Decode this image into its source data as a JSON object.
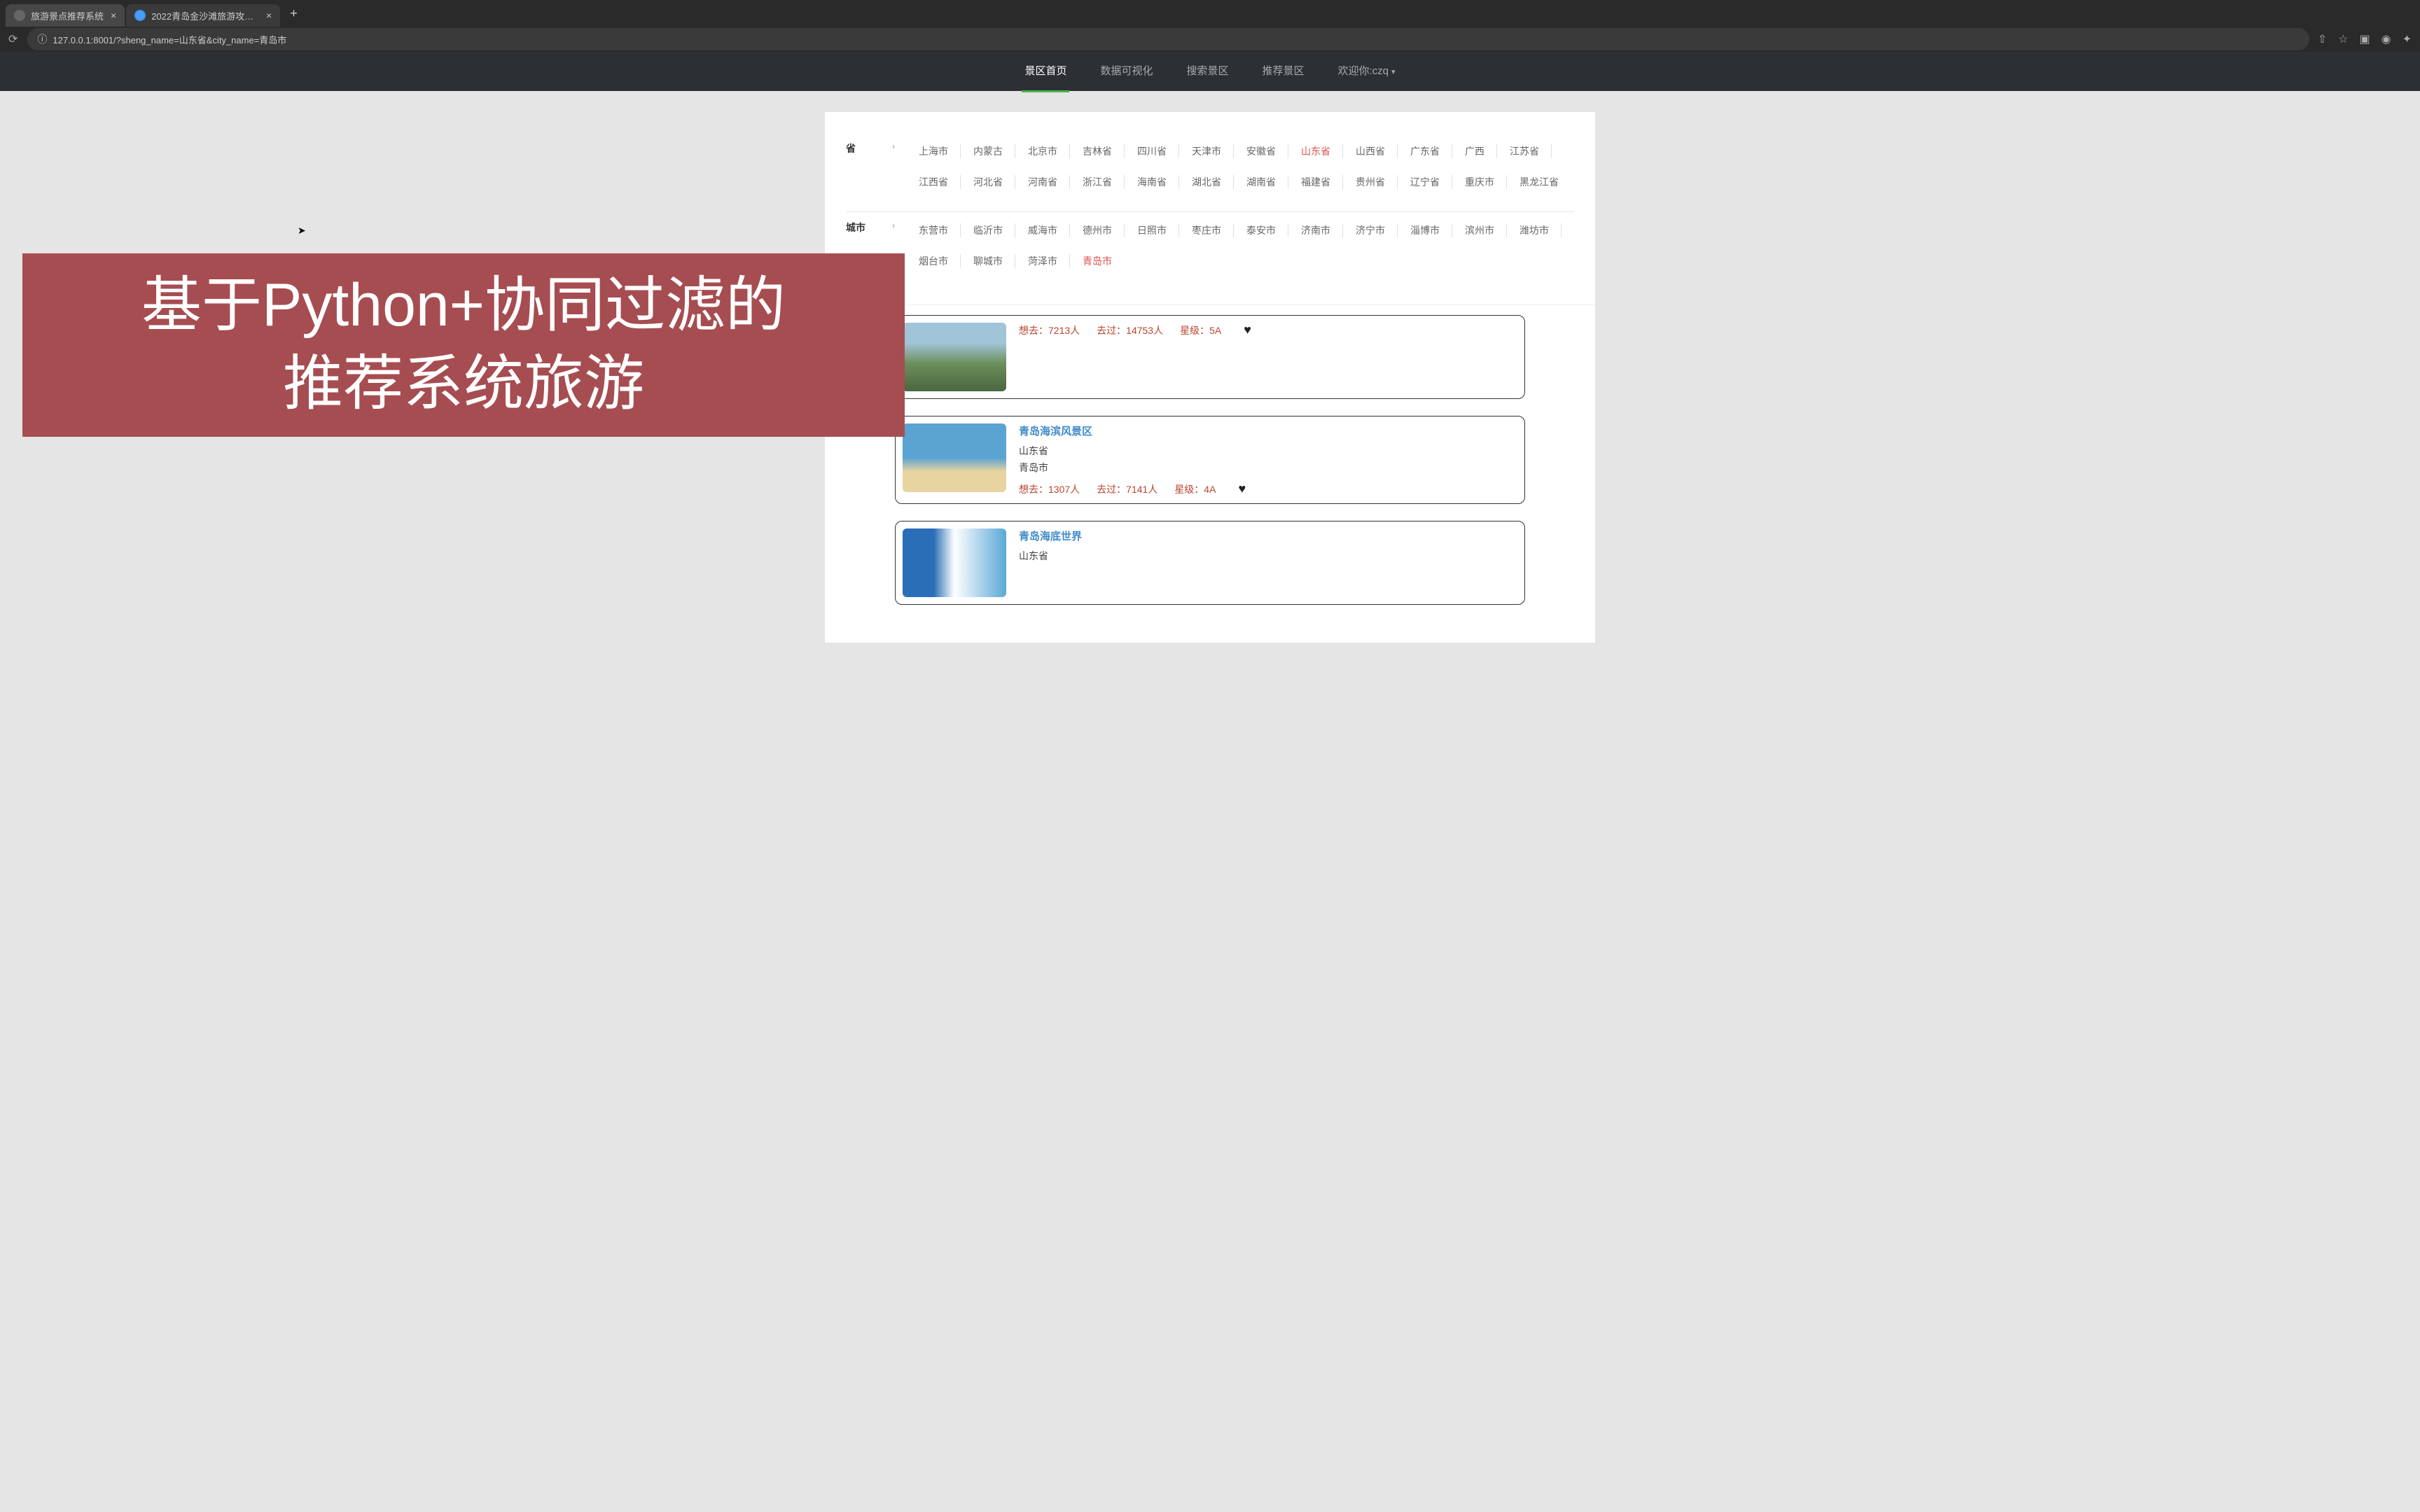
{
  "browser": {
    "tabs": [
      {
        "title": "旅游景点推荐系统",
        "active": true
      },
      {
        "title": "2022青岛金沙滩旅游攻略-金沙...",
        "active": false
      }
    ],
    "url": "127.0.0.1:8001/?sheng_name=山东省&city_name=青岛市"
  },
  "nav": {
    "items": [
      {
        "label": "景区首页",
        "active": true
      },
      {
        "label": "数据可视化"
      },
      {
        "label": "搜索景区"
      },
      {
        "label": "推荐景区"
      },
      {
        "label": "欢迎你:czq",
        "dropdown": true
      }
    ]
  },
  "filters": {
    "province_label": "省",
    "provinces": [
      "上海市",
      "内蒙古",
      "北京市",
      "吉林省",
      "四川省",
      "天津市",
      "安徽省",
      "山东省",
      "山西省",
      "广东省",
      "广西",
      "江苏省",
      "江西省",
      "河北省",
      "河南省",
      "浙江省",
      "海南省",
      "湖北省",
      "湖南省",
      "福建省",
      "贵州省",
      "辽宁省",
      "重庆市",
      "黑龙江省"
    ],
    "province_selected": "山东省",
    "city_label": "城市",
    "cities": [
      "东营市",
      "临沂市",
      "威海市",
      "德州市",
      "日照市",
      "枣庄市",
      "泰安市",
      "济南市",
      "济宁市",
      "淄博市",
      "滨州市",
      "潍坊市",
      "烟台市",
      "聊城市",
      "菏泽市",
      "青岛市"
    ],
    "city_selected": "青岛市"
  },
  "overlay": {
    "line1": "基于Python+协同过滤的",
    "line2": "推荐系统旅游"
  },
  "stats_labels": {
    "want": "想去：",
    "been": "去过：",
    "star": "星级：",
    "people": "人"
  },
  "cards": [
    {
      "title": "",
      "province": "",
      "city": "",
      "want": "7213",
      "been": "14753",
      "star": "5A",
      "style": "mountain"
    },
    {
      "title": "青岛海滨风景区",
      "province": "山东省",
      "city": "青岛市",
      "want": "1307",
      "been": "7141",
      "star": "4A",
      "style": "beach"
    },
    {
      "title": "青岛海底世界",
      "province": "山东省",
      "city": "",
      "want": "",
      "been": "",
      "star": "",
      "style": "underwater"
    }
  ]
}
